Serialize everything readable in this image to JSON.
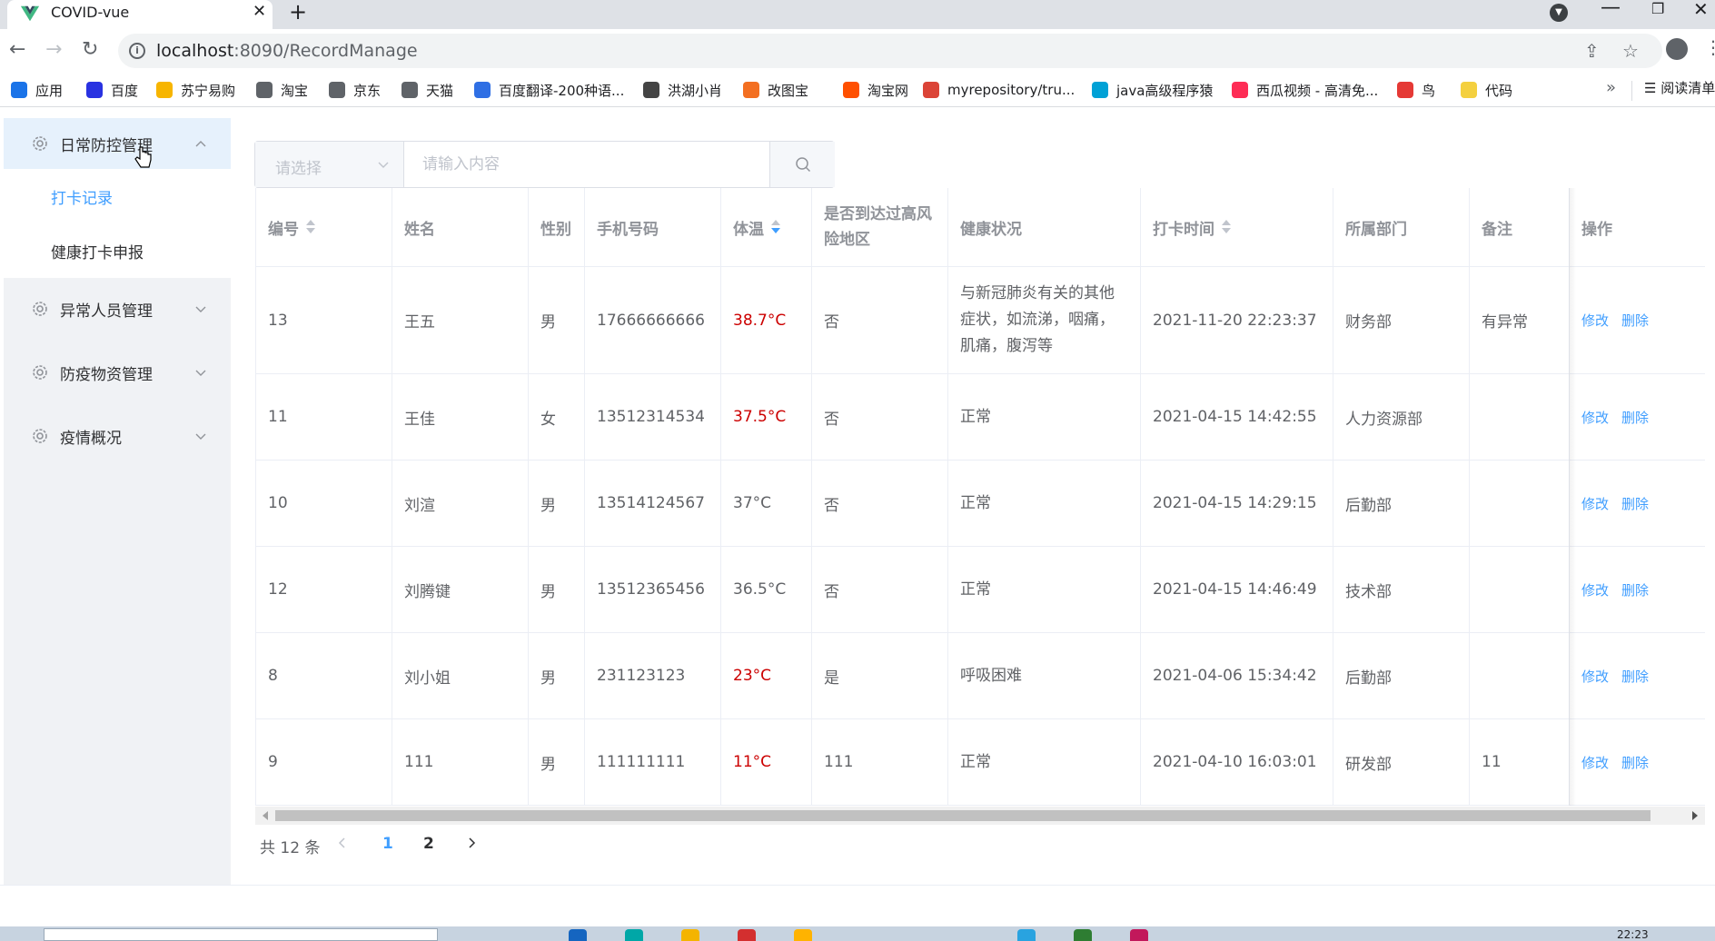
{
  "browser": {
    "tab_title": "COVID-vue",
    "url_host": "localhost",
    "url_path": ":8090/RecordManage",
    "bookmarks": [
      {
        "label": "应用",
        "color": "#1a73e8"
      },
      {
        "label": "百度",
        "color": "#2932e1"
      },
      {
        "label": "苏宁易购",
        "color": "#f7b500"
      },
      {
        "label": "淘宝",
        "color": "#5f6368"
      },
      {
        "label": "京东",
        "color": "#5f6368"
      },
      {
        "label": "天猫",
        "color": "#5f6368"
      },
      {
        "label": "百度翻译-200种语...",
        "color": "#2f6fe4"
      },
      {
        "label": "洪湖小肖",
        "color": "#444444"
      },
      {
        "label": "改图宝",
        "color": "#f36f21"
      },
      {
        "label": "淘宝网",
        "color": "#ff5000"
      },
      {
        "label": "myrepository/tru...",
        "color": "#db4437"
      },
      {
        "label": "java高级程序猿",
        "color": "#00a1d6"
      },
      {
        "label": "西瓜视频 - 高清免...",
        "color": "#fe2c55"
      },
      {
        "label": "鸟",
        "color": "#e53935"
      },
      {
        "label": "代码",
        "color": "#f4d03f"
      }
    ],
    "bookmarks_more": "»",
    "reading_list": "阅读清单",
    "clock": "22:23"
  },
  "sidebar": {
    "menus": [
      {
        "label": "日常防控管理",
        "expanded": true
      },
      {
        "label": "异常人员管理",
        "expanded": false
      },
      {
        "label": "防疫物资管理",
        "expanded": false
      },
      {
        "label": "疫情概况",
        "expanded": false
      }
    ],
    "submenu": [
      {
        "label": "打卡记录",
        "current": true
      },
      {
        "label": "健康打卡申报",
        "current": false
      }
    ]
  },
  "search": {
    "select_placeholder": "请选择",
    "input_placeholder": "请输入内容"
  },
  "table": {
    "columns": [
      "编号",
      "姓名",
      "性别",
      "手机号码",
      "体温",
      "是否到达过高风险地区",
      "健康状况",
      "打卡时间",
      "所属部门",
      "备注",
      "操作"
    ],
    "column_lines": {
      "high_risk": [
        "是否到达过高风",
        "险地区"
      ]
    },
    "rows": [
      {
        "id": "13",
        "name": "王五",
        "gender": "男",
        "phone": "17666666666",
        "temp": "38.7°C",
        "temp_abnormal": true,
        "risk": "否",
        "health_lines": [
          "与新冠肺炎有关的其他",
          "症状，如流涕，咽痛，",
          "肌痛，腹泻等"
        ],
        "time": "2021-11-20 22:23:37",
        "dept": "财务部",
        "note": "有异常"
      },
      {
        "id": "11",
        "name": "王佳",
        "gender": "女",
        "phone": "13512314534",
        "temp": "37.5°C",
        "temp_abnormal": true,
        "risk": "否",
        "health_lines": [
          "正常"
        ],
        "time": "2021-04-15 14:42:55",
        "dept": "人力资源部",
        "note": ""
      },
      {
        "id": "10",
        "name": "刘渲",
        "gender": "男",
        "phone": "13514124567",
        "temp": "37°C",
        "temp_abnormal": false,
        "risk": "否",
        "health_lines": [
          "正常"
        ],
        "time": "2021-04-15 14:29:15",
        "dept": "后勤部",
        "note": ""
      },
      {
        "id": "12",
        "name": "刘腾键",
        "gender": "男",
        "phone": "13512365456",
        "temp": "36.5°C",
        "temp_abnormal": false,
        "risk": "否",
        "health_lines": [
          "正常"
        ],
        "time": "2021-04-15 14:46:49",
        "dept": "技术部",
        "note": ""
      },
      {
        "id": "8",
        "name": "刘小姐",
        "gender": "男",
        "phone": "231123123",
        "temp": "23°C",
        "temp_abnormal": true,
        "risk": "是",
        "health_lines": [
          "呼吸困难"
        ],
        "time": "2021-04-06 15:34:42",
        "dept": "后勤部",
        "note": ""
      },
      {
        "id": "9",
        "name": "111",
        "gender": "男",
        "phone": "111111111",
        "temp": "11°C",
        "temp_abnormal": true,
        "risk": "111",
        "health_lines": [
          "正常"
        ],
        "time": "2021-04-10 16:03:01",
        "dept": "研发部",
        "note": "11"
      }
    ],
    "actions": {
      "edit": "修改",
      "delete": "删除"
    },
    "abnormal_color": "#cc0000",
    "accent_color": "#409eff"
  },
  "pagination": {
    "total": "共 12 条",
    "pages": [
      "1",
      "2"
    ],
    "current": "1"
  }
}
